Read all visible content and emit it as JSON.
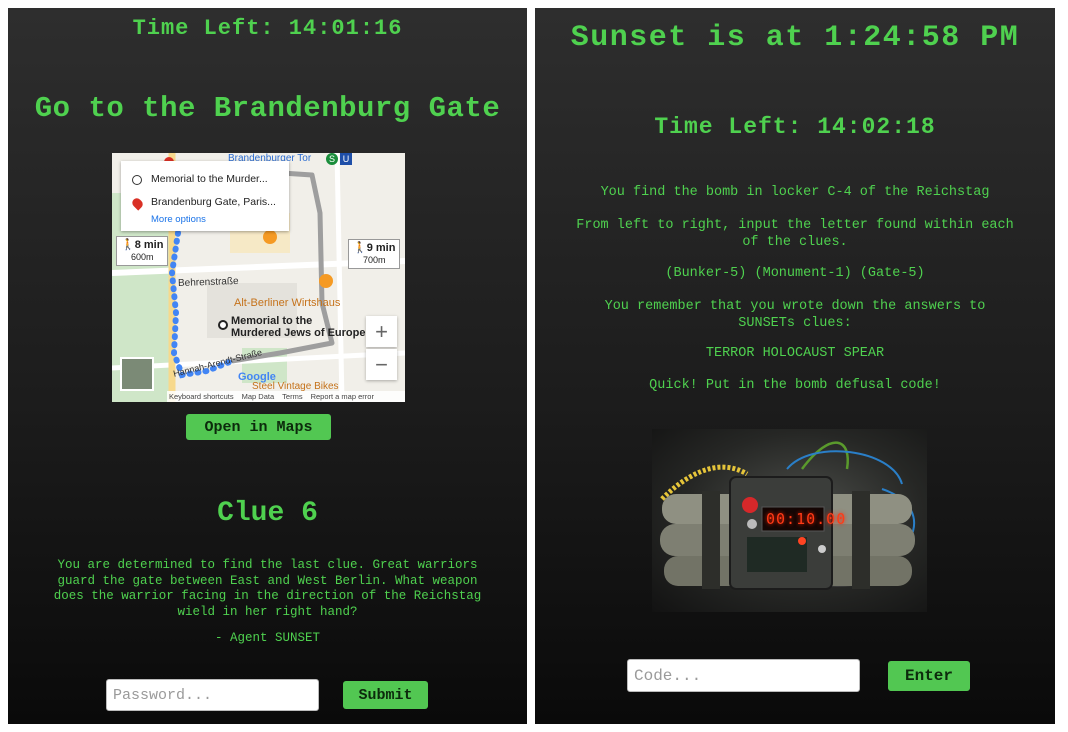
{
  "left": {
    "timer": "Time Left: 14:01:16",
    "heading": "Go to the Brandenburg Gate",
    "map": {
      "card_origin": "Memorial to the Murder...",
      "card_destination": "Brandenburg Gate, Paris...",
      "card_more": "More options",
      "label_brandenburger_tor": "Brandenburger Tor",
      "walk_left_time": "8 min",
      "walk_left_dist": "600m",
      "walk_right_time": "9 min",
      "walk_right_dist": "700m",
      "label_behrenstrasse": "Behrenstraße",
      "label_restaurant": "Alt-Berliner Wirtshaus",
      "label_memorial_1": "Memorial to the",
      "label_memorial_2": "Murdered Jews of Europe",
      "label_hannah": "Hannah-Arendt-Straße",
      "label_vintage": "Steel Vintage Bikes",
      "logo": "Google",
      "footer_shortcuts": "Keyboard shortcuts",
      "footer_data": "Map Data",
      "footer_terms": "Terms",
      "footer_report": "Report a map error",
      "zoom_in": "+",
      "zoom_out": "−",
      "badge_s": "S",
      "badge_u": "U"
    },
    "open_maps_label": "Open in Maps",
    "clue_title": "Clue 6",
    "clue_line1": "You are determined to find the last clue. Great warriors",
    "clue_line2": "guard the gate between East and West Berlin. What weapon",
    "clue_line3": "does the warrior facing in the direction of the Reichstag",
    "clue_line4": "wield in her right hand?",
    "clue_signature": "- Agent SUNSET",
    "password_placeholder": "Password...",
    "submit_label": "Submit"
  },
  "right": {
    "sunset": "Sunset is at 1:24:58 PM",
    "timer": "Time Left: 14:02:18",
    "line1": "You find the bomb in locker C-4 of the Reichstag",
    "line2a": "From left to right, input the letter found within each",
    "line2b": "of the clues.",
    "line3": "(Bunker-5) (Monument-1) (Gate-5)",
    "line4a": "You remember that you wrote down the answers to",
    "line4b": "SUNSETs clues:",
    "line5": "TERROR HOLOCAUST SPEAR",
    "line6": "Quick! Put in the bomb defusal code!",
    "bomb_display": "00:10.00",
    "code_placeholder": "Code...",
    "enter_label": "Enter"
  },
  "colors": {
    "terminal_green": "#4fd14f",
    "button_green": "#52c752",
    "route_blue": "#4285f4"
  }
}
